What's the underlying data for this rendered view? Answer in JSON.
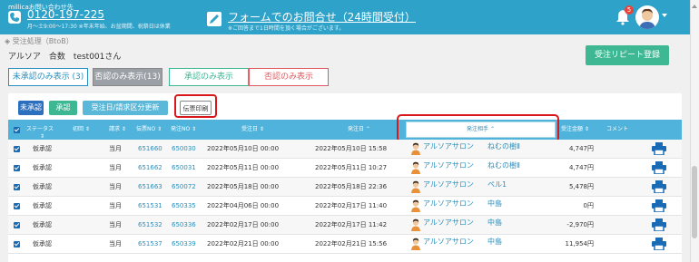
{
  "header": {
    "contact_label": "millicaお問い合わせ先",
    "phone_icon": "phone-icon",
    "phone": "0120-197-225",
    "phone_hours": "月〜土9:00〜17:30 ※年末年始、お盆期間、祝祭日は休業",
    "form_icon": "pencil-icon",
    "form_link": "フォームでのお問合せ（24時間受付）",
    "form_note": "※ご回答まで1日時間を頂く場合がございます。",
    "notification_count": "5"
  },
  "breadcrumb": "◈ 受注処理（BtoB）",
  "store_line": "アルソア　合数　test001さん",
  "repeat_button": "受注リピート登録",
  "filter_tabs": {
    "all": "未承認のみ表示 (3)",
    "pending": "否認のみ表示(13)",
    "approved": "承認のみ表示",
    "rejected": "否認のみ表示"
  },
  "actions": {
    "pending": "未承認",
    "approve": "承認",
    "update": "受注日/請求区分更新",
    "print": "伝票印刷"
  },
  "table": {
    "headers": {
      "status": "ステータス",
      "status_sort": "⇕",
      "first": "初回 ⇕",
      "bill": "請求 ⇕",
      "slip": "伝票NO ⇕",
      "order_no": "発注NO ⇕",
      "order_date": "受注日 ⇕",
      "issue_date": "発注日 ⌃",
      "orderer": "発注相手 ⌃",
      "amount": "受注金額 ⇕",
      "comment": "コメント"
    },
    "rows": [
      {
        "status": "仮承認",
        "bill": "当月",
        "slip": "651660",
        "order_no": "650030",
        "order_date": "2022年05月10日 00:00",
        "issue_date": "2022年05月10日 15:58",
        "name": "アルソアサロン",
        "branch": "ねむの樹Ⅱ",
        "amount": "4,747円"
      },
      {
        "status": "仮承認",
        "bill": "当月",
        "slip": "651662",
        "order_no": "650031",
        "order_date": "2022年05月11日 00:00",
        "issue_date": "2022年05月11日 10:27",
        "name": "アルソアサロン",
        "branch": "ねむの樹Ⅱ",
        "amount": "4,747円"
      },
      {
        "status": "仮承認",
        "bill": "当月",
        "slip": "651663",
        "order_no": "650072",
        "order_date": "2022年05月18日 00:00",
        "issue_date": "2022年05月18日 22:36",
        "name": "アルソアサロン",
        "branch": "ペル1",
        "amount": "5,478円"
      },
      {
        "status": "仮承認",
        "bill": "当月",
        "slip": "651531",
        "order_no": "650335",
        "order_date": "2022年04月06日 00:00",
        "issue_date": "2022年02月17日 11:40",
        "name": "アルソアサロン",
        "branch": "中島",
        "amount": "0円"
      },
      {
        "status": "仮承認",
        "bill": "当月",
        "slip": "651532",
        "order_no": "650336",
        "order_date": "2022年02月17日 00:00",
        "issue_date": "2022年02月17日 11:42",
        "name": "アルソアサロン",
        "branch": "中島",
        "amount": "-2,970円"
      },
      {
        "status": "仮承認",
        "bill": "当月",
        "slip": "651537",
        "order_no": "650339",
        "order_date": "2022年02月21日 00:00",
        "issue_date": "2022年02月21日 15:56",
        "name": "アルソアサロン",
        "branch": "中島",
        "amount": "11,954円"
      }
    ]
  },
  "colors": {
    "header": "#2ea2c9",
    "accent_green": "#3eb892",
    "accent_red": "#e05a62",
    "highlight": "#d9181c"
  }
}
